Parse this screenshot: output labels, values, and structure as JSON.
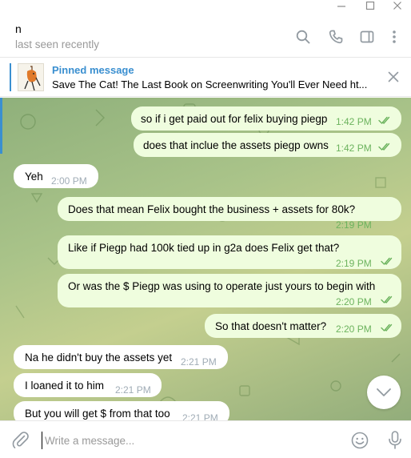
{
  "chat": {
    "peer_name": "n",
    "peer_status": "last seen recently"
  },
  "pinned": {
    "title": "Pinned message",
    "text": "Save The Cat! The Last Book on Screenwriting You'll Ever Need ht..."
  },
  "messages": [
    {
      "dir": "out",
      "text": "so if i get paid out for felix buying piegp",
      "time": "1:42 PM",
      "read": true
    },
    {
      "dir": "out",
      "text": "does that inclue the assets piegp owns",
      "time": "1:42 PM",
      "read": true
    },
    {
      "dir": "in",
      "text": "Yeh",
      "time": "2:00 PM"
    },
    {
      "dir": "out",
      "text": "Does that mean Felix bought the business + assets for 80k?",
      "time": "2:19 PM",
      "read": true
    },
    {
      "dir": "out",
      "text": "Like if Piegp had 100k tied up in g2a does Felix get that?",
      "time": "2:19 PM",
      "read": true
    },
    {
      "dir": "out",
      "text": "Or was the $ Piegp was using to operate just yours to begin with",
      "time": "2:20 PM",
      "read": true
    },
    {
      "dir": "out",
      "text": "So that doesn't matter?",
      "time": "2:20 PM",
      "read": true
    },
    {
      "dir": "in",
      "text": "Na he didn't buy the assets yet",
      "time": "2:21 PM"
    },
    {
      "dir": "in",
      "text": "I loaned it to him",
      "time": "2:21 PM"
    },
    {
      "dir": "in",
      "text": "But you will get $ from that too",
      "time": "2:21 PM"
    }
  ],
  "composer": {
    "placeholder": "Write a message..."
  },
  "colors": {
    "accent": "#3a8fd0",
    "outgoing_bubble": "#effdde",
    "incoming_bubble": "#ffffff",
    "outgoing_time": "#6cb35e"
  },
  "icons": {
    "header": [
      "search-icon",
      "phone-icon",
      "sidebar-toggle-icon",
      "more-vertical-icon"
    ],
    "window": [
      "minimize-icon",
      "maximize-icon",
      "close-icon"
    ],
    "composer": [
      "paperclip-icon",
      "emoji-icon",
      "microphone-icon"
    ]
  }
}
